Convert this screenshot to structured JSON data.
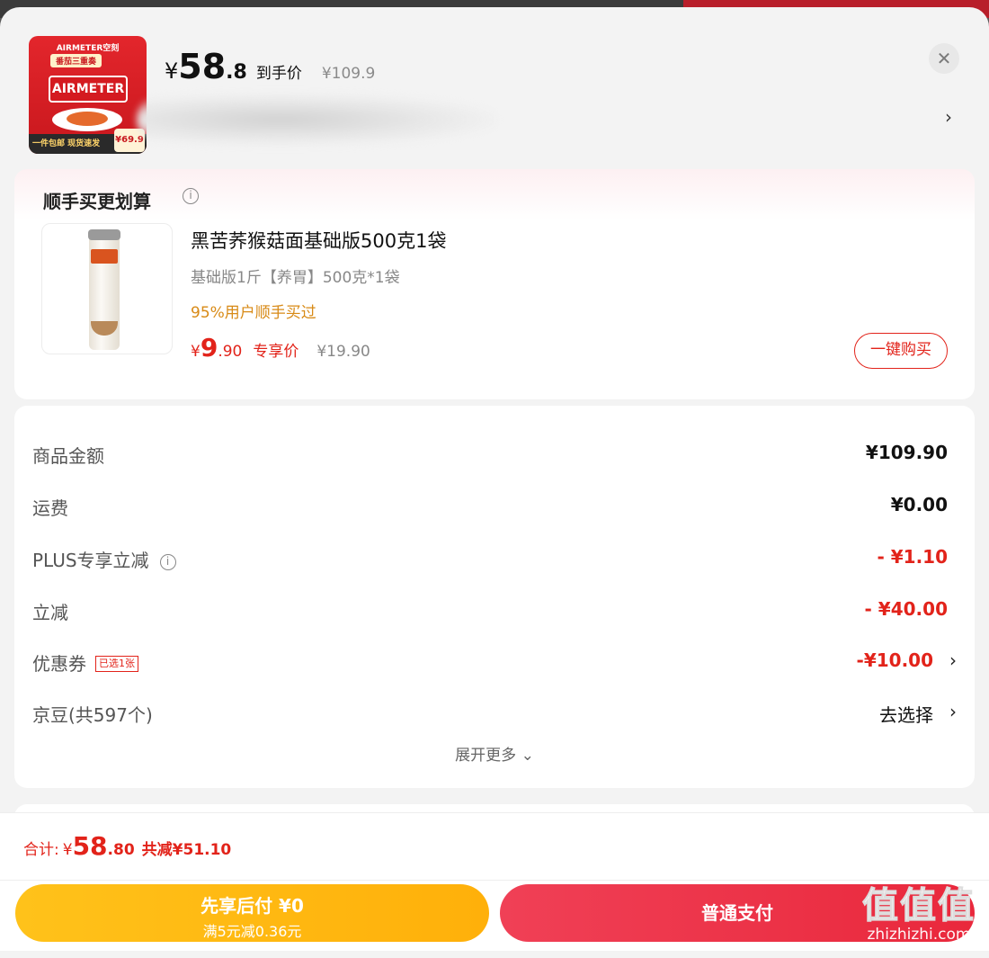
{
  "header": {
    "product_thumb": {
      "brand_small": "AIRMETER空刻",
      "tagline": "番茄三重奏",
      "logo": "AIRMETER",
      "bottom_text": "一件包邮 现货速发",
      "price_tag": "¥69.9"
    },
    "price_currency": "¥",
    "price_int": "58",
    "price_dec": ".8",
    "price_label": "到手价",
    "original_price": "¥109.9",
    "close_icon": "close-icon",
    "chevron": "chevron-right-icon"
  },
  "combo": {
    "title": "顺手买更划算",
    "info_icon": "info-icon",
    "item": {
      "name": "黑苦荞猴菇面基础版500克1袋",
      "spec": "基础版1斤【养胃】500克*1袋",
      "bought": "95%用户顺手买过",
      "price_currency": "¥",
      "price_int": "9",
      "price_dec": ".90",
      "price_label": "专享价",
      "original_price": "¥19.90",
      "button": "一键购买"
    }
  },
  "summary": {
    "rows": [
      {
        "label": "商品金额",
        "value": "¥109.90"
      },
      {
        "label": "运费",
        "value": "¥0.00"
      },
      {
        "label": "PLUS专享立减",
        "value": "- ¥1.10"
      },
      {
        "label": "立减",
        "value": "- ¥40.00"
      },
      {
        "label": "优惠券",
        "badge": "已选1张",
        "value": "-¥10.00"
      },
      {
        "label": "京豆(共597个)",
        "value": "去选择"
      }
    ],
    "expand": "展开更多"
  },
  "footer": {
    "total_label": "合计:",
    "total_currency": "¥",
    "total_int": "58",
    "total_dec": ".80",
    "total_saved": "共减¥51.10",
    "later_line1": "先享后付 ¥0",
    "later_line2": "满5元减0.36元",
    "pay_button": "普通支付"
  },
  "watermark": {
    "big": "值值值",
    "small": "zhizhizhi.com"
  },
  "colors": {
    "accent_red": "#e2231a",
    "gold": "#ffb00a",
    "orange_text": "#d88a16"
  }
}
